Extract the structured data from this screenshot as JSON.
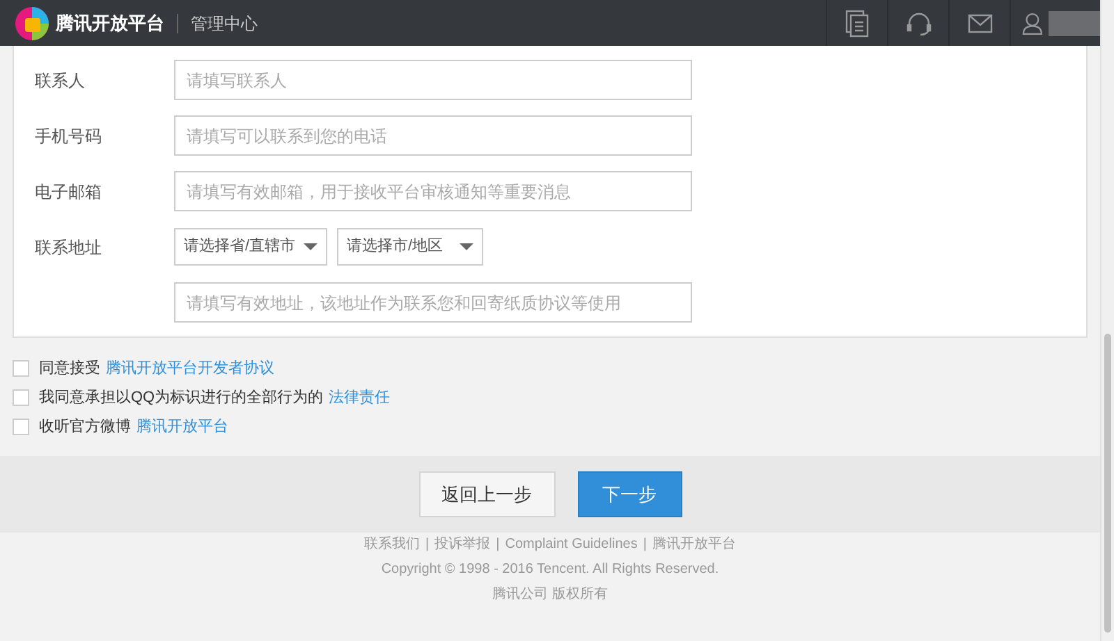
{
  "header": {
    "brand": "腾讯开放平台",
    "section": "管理中心"
  },
  "form": {
    "fields": [
      {
        "kind": "input",
        "label": "联系人",
        "placeholder": "请填写联系人"
      },
      {
        "kind": "input",
        "label": "手机号码",
        "placeholder": "请填写可以联系到您的电话"
      },
      {
        "kind": "input",
        "label": "电子邮箱",
        "placeholder": "请填写有效邮箱，用于接收平台审核通知等重要消息"
      },
      {
        "kind": "selects",
        "label": "联系地址",
        "selects": [
          "请选择省/直辖市",
          "请选择市/地区"
        ]
      },
      {
        "kind": "input",
        "placeholder": "请填写有效地址，该地址作为联系您和回寄纸质协议等使用"
      }
    ]
  },
  "agreements": [
    {
      "checked": false,
      "text": "同意接受",
      "link": "腾讯开放平台开发者协议"
    },
    {
      "checked": false,
      "text": "我同意承担以QQ为标识进行的全部行为的",
      "link": "法律责任"
    },
    {
      "checked": false,
      "text": "收听官方微博",
      "link": "腾讯开放平台"
    }
  ],
  "buttons": {
    "back": "返回上一步",
    "next": "下一步"
  },
  "footer": {
    "links": [
      "联系我们",
      "投诉举报",
      "Complaint Guidelines",
      "腾讯开放平台"
    ],
    "separator": "|",
    "copyright": "Copyright © 1998 - 2016 Tencent. All Rights Reserved.",
    "company": "腾讯公司 版权所有"
  }
}
